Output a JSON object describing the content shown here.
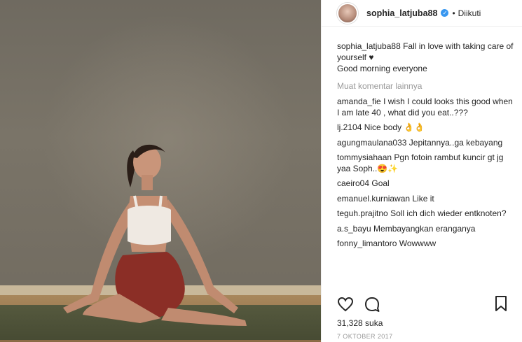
{
  "post": {
    "author": "sophia_latjuba88",
    "follow_state": "Diikuti",
    "dot": "•",
    "caption_lines": [
      "Fall in love with taking care of yourself ♥",
      "Good morning everyone"
    ],
    "load_more": "Muat komentar lainnya",
    "comments": [
      {
        "user": "amanda_fie",
        "text": "I wish I could looks this good when I am late 40 , what did you eat..???"
      },
      {
        "user": "lj.2104",
        "text": "Nice body 👌👌"
      },
      {
        "user": "agungmaulana033",
        "text": "Jepitannya..ga kebayang"
      },
      {
        "user": "tommysiahaan",
        "text": "Pgn fotoin rambut kuncir gt jg yaa Soph..😍✨"
      },
      {
        "user": "caeiro04",
        "text": "Goal"
      },
      {
        "user": "emanuel.kurniawan",
        "text": "Like it"
      },
      {
        "user": "teguh.prajitno",
        "text": "Soll ich dich wieder entknoten?"
      },
      {
        "user": "a.s_bayu",
        "text": "Membayangkan eranganya"
      },
      {
        "user": "fonny_limantoro",
        "text": "Wowwww"
      }
    ],
    "likes": "31,328 suka",
    "date": "7 OKTOBER 2017"
  },
  "icons": {
    "heart": "heart-icon",
    "comment": "comment-icon",
    "bookmark": "bookmark-icon",
    "verified": "verified-badge-icon"
  },
  "colors": {
    "verified": "#3897f0",
    "muted": "#999999",
    "text": "#262626"
  }
}
